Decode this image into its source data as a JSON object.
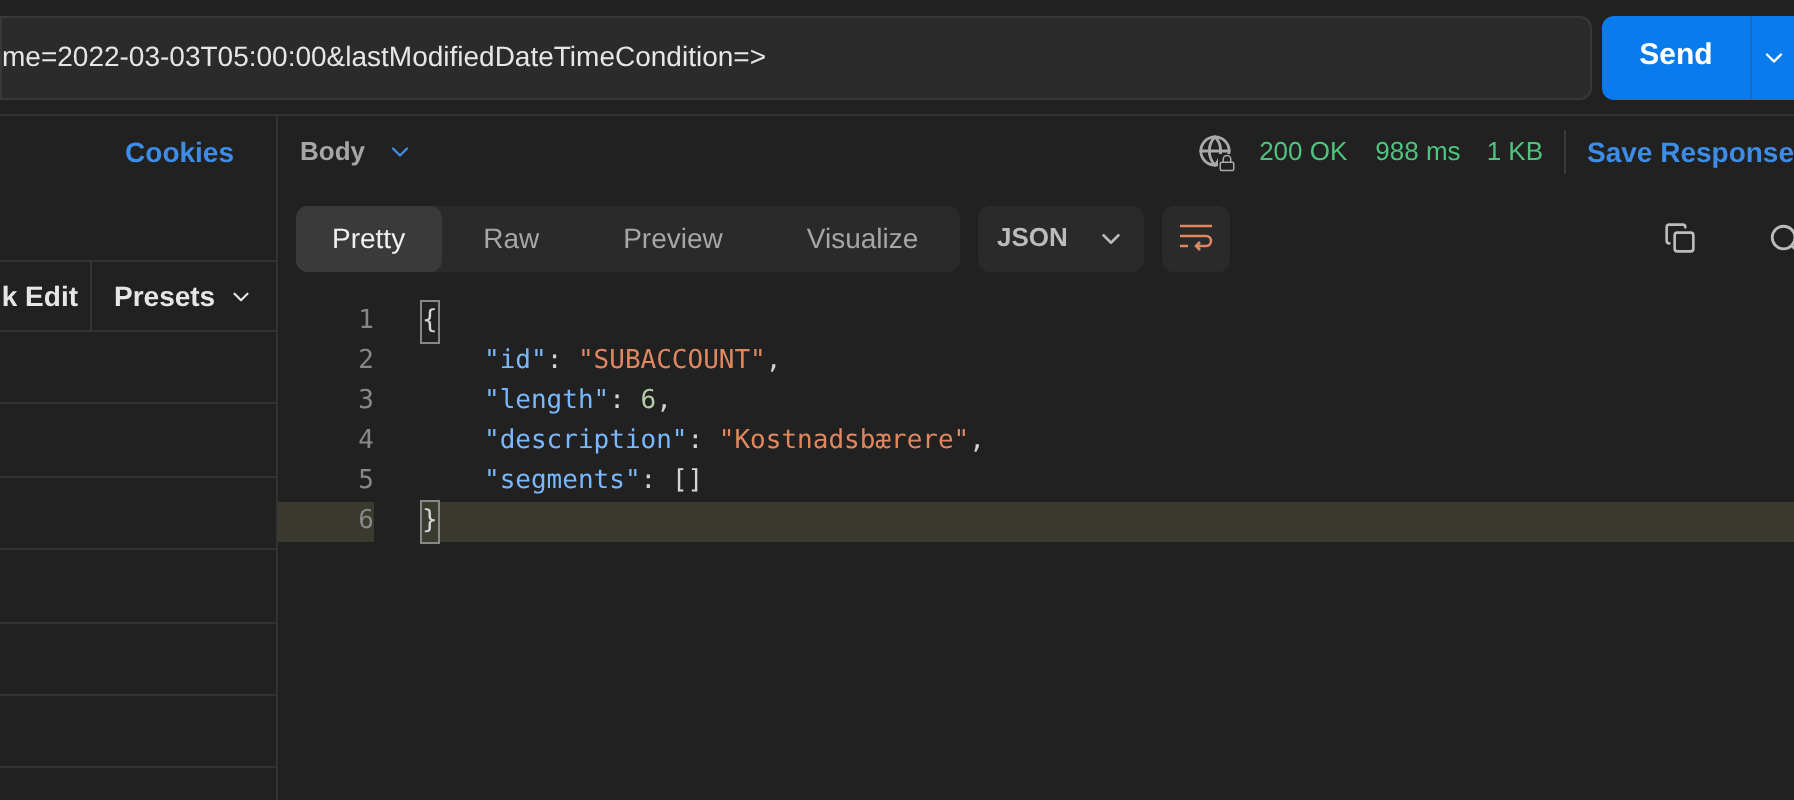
{
  "url_field": {
    "value": "me=2022-03-03T05:00:00&lastModifiedDateTimeCondition=>"
  },
  "send_button": {
    "label": "Send"
  },
  "left_panel": {
    "cookies_link": "Cookies",
    "columns": [
      "k Edit",
      "Presets"
    ]
  },
  "response": {
    "body_menu": "Body",
    "status": "200 OK",
    "time": "988 ms",
    "size": "1 KB",
    "save_response": "Save Response",
    "view_tabs": [
      {
        "label": "Pretty",
        "selected": true
      },
      {
        "label": "Raw",
        "selected": false
      },
      {
        "label": "Preview",
        "selected": false
      },
      {
        "label": "Visualize",
        "selected": false
      }
    ],
    "format": "JSON",
    "code_lines": [
      {
        "number": "1",
        "current": false,
        "tokens": [
          {
            "kind": "bracket",
            "text": "{"
          }
        ]
      },
      {
        "number": "2",
        "current": false,
        "tokens": [
          {
            "kind": "key",
            "text": "\"id\""
          },
          {
            "kind": "punct",
            "text": ": "
          },
          {
            "kind": "string",
            "text": "\"SUBACCOUNT\""
          },
          {
            "kind": "punct",
            "text": ","
          }
        ]
      },
      {
        "number": "3",
        "current": false,
        "tokens": [
          {
            "kind": "key",
            "text": "\"length\""
          },
          {
            "kind": "punct",
            "text": ": "
          },
          {
            "kind": "number",
            "text": "6"
          },
          {
            "kind": "punct",
            "text": ","
          }
        ]
      },
      {
        "number": "4",
        "current": false,
        "tokens": [
          {
            "kind": "key",
            "text": "\"description\""
          },
          {
            "kind": "punct",
            "text": ": "
          },
          {
            "kind": "string",
            "text": "\"Kostnadsbærere\""
          },
          {
            "kind": "punct",
            "text": ","
          }
        ]
      },
      {
        "number": "5",
        "current": false,
        "tokens": [
          {
            "kind": "key",
            "text": "\"segments\""
          },
          {
            "kind": "punct",
            "text": ": "
          },
          {
            "kind": "punct",
            "text": "[]"
          }
        ]
      },
      {
        "number": "6",
        "current": true,
        "tokens": [
          {
            "kind": "bracket",
            "text": "}"
          }
        ]
      }
    ]
  }
}
